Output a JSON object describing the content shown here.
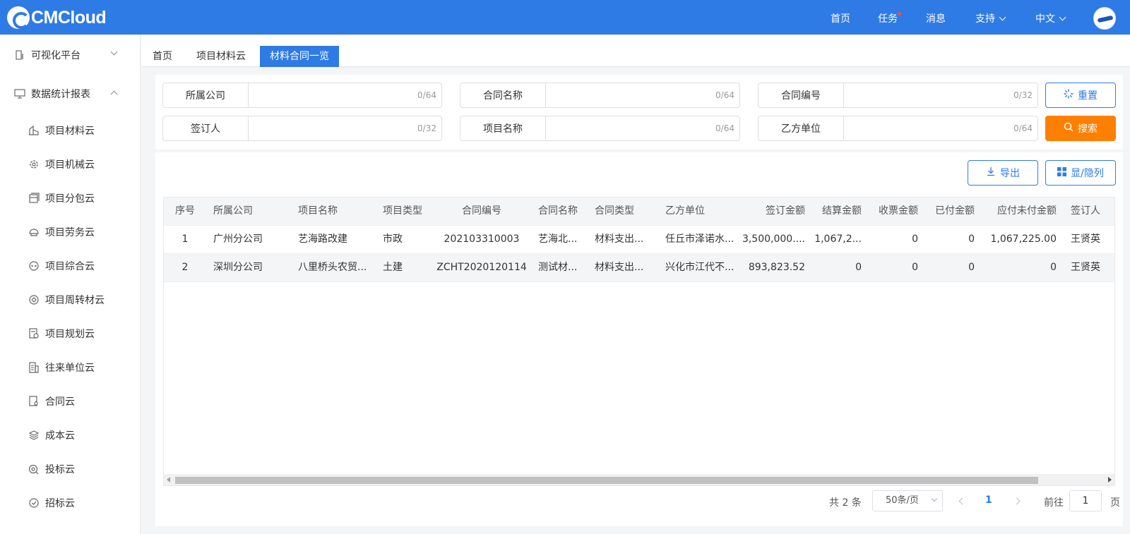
{
  "header": {
    "brand": "CMCloud",
    "nav": [
      {
        "label": "首页"
      },
      {
        "label": "任务"
      },
      {
        "label": "消息"
      },
      {
        "label": "支持"
      },
      {
        "label": "中文"
      }
    ],
    "avatar_icon": "user-avatar"
  },
  "sidebar": {
    "groups": [
      {
        "label": "可视化平台",
        "icon": "building-icon",
        "expanded": false
      },
      {
        "label": "数据统计报表",
        "icon": "report-icon",
        "expanded": true
      }
    ],
    "items": [
      {
        "label": "项目材料云",
        "icon": "materials-icon"
      },
      {
        "label": "项目机械云",
        "icon": "machinery-gear-icon"
      },
      {
        "label": "项目分包云",
        "icon": "subcontract-icon"
      },
      {
        "label": "项目劳务云",
        "icon": "labor-helmet-icon"
      },
      {
        "label": "项目综合云",
        "icon": "comprehensive-icon"
      },
      {
        "label": "项目周转材云",
        "icon": "turnover-icon"
      },
      {
        "label": "项目规划云",
        "icon": "planning-icon"
      },
      {
        "label": "往来单位云",
        "icon": "company-icon"
      },
      {
        "label": "合同云",
        "icon": "contract-icon"
      },
      {
        "label": "成本云",
        "icon": "cost-layers-icon"
      },
      {
        "label": "投标云",
        "icon": "bid-icon"
      },
      {
        "label": "招标云",
        "icon": "tender-icon"
      }
    ]
  },
  "tabs": [
    {
      "label": "首页"
    },
    {
      "label": "项目材料云"
    },
    {
      "label": "材料合同一览",
      "active": true
    }
  ],
  "filters": [
    {
      "label": "所属公司",
      "count": "0/64"
    },
    {
      "label": "合同名称",
      "count": "0/64"
    },
    {
      "label": "合同编号",
      "count": "0/32"
    },
    {
      "label": "签订人",
      "count": "0/32"
    },
    {
      "label": "项目名称",
      "count": "0/64"
    },
    {
      "label": "乙方单位",
      "count": "0/64"
    }
  ],
  "buttons": {
    "reset": "重置",
    "search": "搜索",
    "export": "导出",
    "columns": "显/隐列"
  },
  "table": {
    "columns": [
      "序号",
      "所属公司",
      "项目名称",
      "项目类型",
      "合同编号",
      "合同名称",
      "合同类型",
      "乙方单位",
      "签订金额",
      "结算金额",
      "收票金额",
      "已付金额",
      "应付未付金额",
      "签订人"
    ],
    "rows": [
      [
        "1",
        "广州分公司",
        "艺海路改建",
        "市政",
        "202103310003",
        "艺海北...",
        "材料支出...",
        "任丘市泽诺水...",
        "3,500,000....",
        "1,067,2...",
        "0",
        "0",
        "1,067,225.00",
        "王贤英"
      ],
      [
        "2",
        "深圳分公司",
        "八里桥头农贸...",
        "土建",
        "ZCHT2020120114",
        "测试材...",
        "材料支出...",
        "兴化市江代不...",
        "893,823.52",
        "0",
        "0",
        "0",
        "0",
        "王贤英"
      ]
    ]
  },
  "pagination": {
    "total": "共 2 条",
    "page_size": "50条/页",
    "current": "1",
    "goto_label": "前往",
    "goto_value": "1",
    "goto_suffix": "页"
  },
  "colors": {
    "primary": "#2f7be5",
    "search": "#ff7f00",
    "task_dot": "#f04a4a"
  }
}
